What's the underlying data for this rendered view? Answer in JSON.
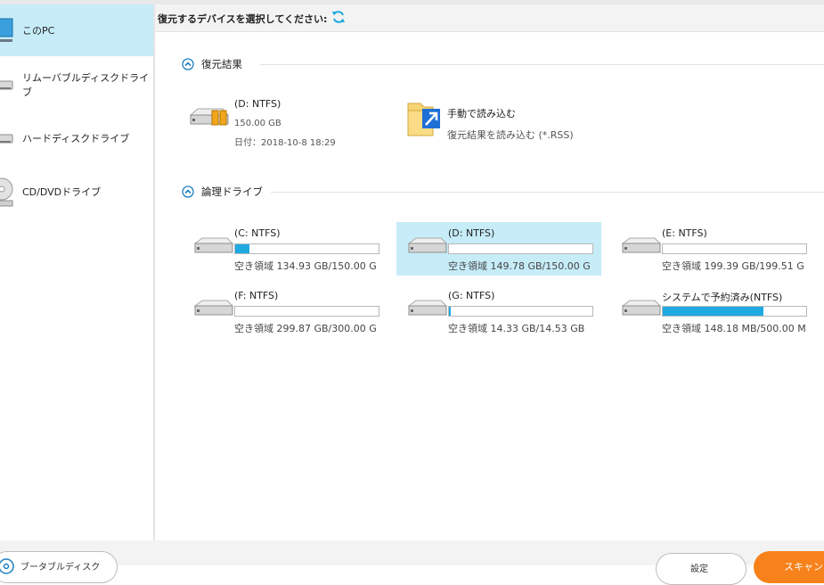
{
  "sidebar": {
    "items": [
      {
        "label": "このPC",
        "icon": "monitor-icon",
        "selected": true
      },
      {
        "label": "リムーバブルディスクドライブ",
        "icon": "removable-drive-icon",
        "selected": false
      },
      {
        "label": "ハードディスクドライブ",
        "icon": "hard-drive-icon",
        "selected": false
      },
      {
        "label": "CD/DVDドライブ",
        "icon": "cd-dvd-icon",
        "selected": false
      }
    ]
  },
  "header": {
    "title": "復元するデバイスを選択してください:",
    "refresh_icon": "refresh-icon"
  },
  "recovery_results": {
    "section_label": "復元結果",
    "saved_result": {
      "name": "(D: NTFS)",
      "size": "150.00 GB",
      "date": "日付：2018-10-8 18:29"
    },
    "manual_load": {
      "title": "手動で読み込む",
      "subtitle": "復元結果を読み込む (*.RSS)"
    }
  },
  "logical_drives": {
    "section_label": "論理ドライブ",
    "drives": [
      {
        "name": "(C: NTFS)",
        "free": "空き領域 134.93 GB/150.00 G",
        "used_fraction": 0.1,
        "selected": false
      },
      {
        "name": "(D: NTFS)",
        "free": "空き領域 149.78 GB/150.00 G",
        "used_fraction": 0.0,
        "selected": true
      },
      {
        "name": "(E: NTFS)",
        "free": "空き領域 199.39 GB/199.51 G",
        "used_fraction": 0.0,
        "selected": false
      },
      {
        "name": "(F: NTFS)",
        "free": "空き領域 299.87 GB/300.00 G",
        "used_fraction": 0.0,
        "selected": false
      },
      {
        "name": "(G: NTFS)",
        "free": "空き領域 14.33 GB/14.53 GB",
        "used_fraction": 0.014,
        "selected": false
      },
      {
        "name": "システムで予約済み(NTFS)",
        "free": "空き領域 148.18 MB/500.00 M",
        "used_fraction": 0.7,
        "selected": false
      }
    ]
  },
  "footer": {
    "bootable_label": "ブータブルディスク",
    "settings_label": "設定",
    "scan_label": "スキャン"
  },
  "colors": {
    "accent": "#1fa9e1",
    "selected_bg": "#c6ecf8",
    "scan_button": "#f7821b"
  }
}
